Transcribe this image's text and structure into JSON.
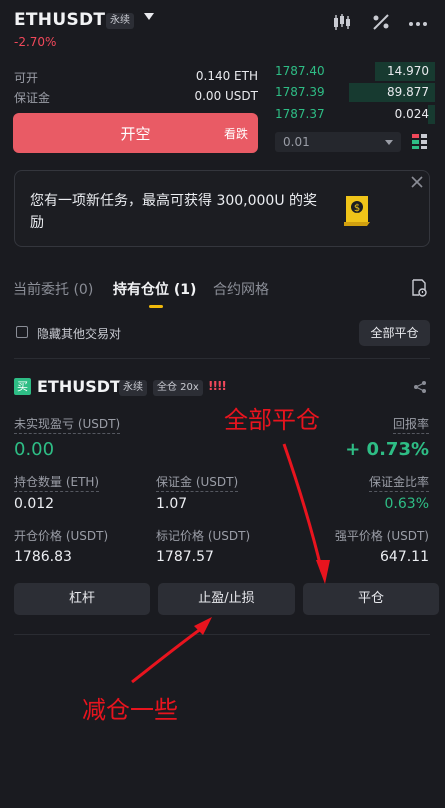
{
  "header": {
    "pair": "ETHUSDT",
    "perp_tag": "永续",
    "change": "-2.70%"
  },
  "account": {
    "available_label": "可开",
    "available_value": "0.140 ETH",
    "margin_label": "保证金",
    "margin_value": "0.00 USDT"
  },
  "open_button": {
    "main": "开空",
    "side": "看跌"
  },
  "orderbook": {
    "rows": [
      {
        "price": "1787.40",
        "qty": "14.970",
        "depth": 0.36
      },
      {
        "price": "1787.39",
        "qty": "89.877",
        "depth": 0.52
      },
      {
        "price": "1787.37",
        "qty": "0.024",
        "depth": 0.04
      }
    ],
    "depth_value": "0.01"
  },
  "task": {
    "text": "您有一项新任务，最高可获得 300,000U 的奖励"
  },
  "tabs": [
    {
      "label": "当前委托 (0)"
    },
    {
      "label": "持有仓位 (1)"
    },
    {
      "label": "合约网格"
    }
  ],
  "filter": {
    "hide_label": "隐藏其他交易对",
    "close_all": "全部平仓"
  },
  "position": {
    "side_tag": "买",
    "symbol": "ETHUSDT",
    "perp_tag": "永续",
    "margin_mode_tag": "全仓 20x",
    "warn": "!!!!",
    "unrealized_label": "未实现盈亏 (USDT)",
    "unrealized_value": "0.00",
    "roe_label": "回报率",
    "roe_value": "+ 0.73%",
    "qty_label": "持仓数量 (ETH)",
    "qty_value": "0.012",
    "margin_label": "保证金 (USDT)",
    "margin_value": "1.07",
    "margin_ratio_label": "保证金比率",
    "margin_ratio_value": "0.63%",
    "entry_label": "开仓价格 (USDT)",
    "entry_value": "1786.83",
    "mark_label": "标记价格 (USDT)",
    "mark_value": "1787.57",
    "liq_label": "强平价格 (USDT)",
    "liq_value": "647.11",
    "btn_leverage": "杠杆",
    "btn_tpsl": "止盈/止损",
    "btn_close": "平仓"
  },
  "annotations": {
    "top": "全部平仓",
    "bottom": "减仓一些",
    "color": "#e8141e"
  },
  "colors": {
    "green": "#2ebd85",
    "red": "#f0485a",
    "accent": "#f0b90b"
  }
}
